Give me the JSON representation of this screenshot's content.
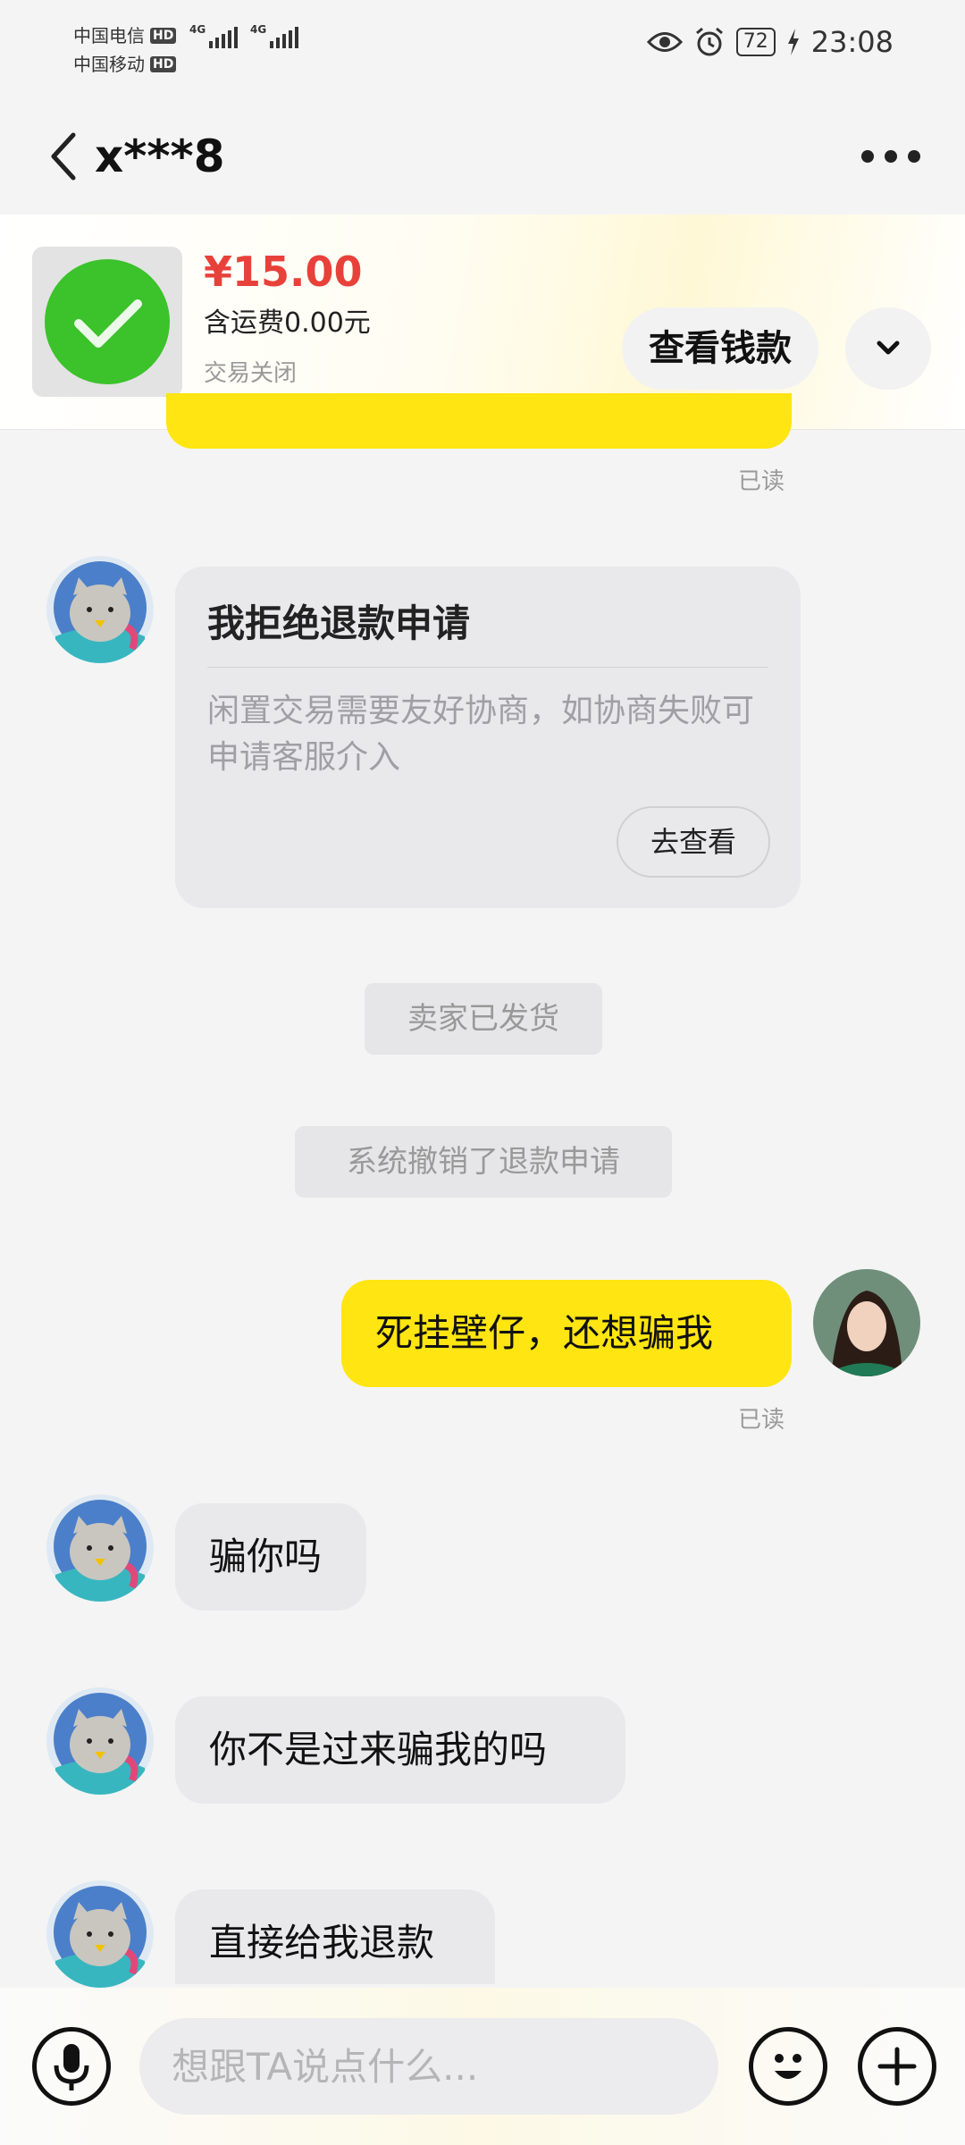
{
  "status_bar": {
    "carrier1": "中国电信",
    "carrier2": "中国移动",
    "hd": "HD",
    "net1": "4G",
    "net2": "4G",
    "battery": "72",
    "time": "23:08"
  },
  "nav": {
    "title": "x***8"
  },
  "order": {
    "price": "¥15.00",
    "shipping": "含运费0.00元",
    "status": "交易关闭",
    "view_money_label": "查看钱款"
  },
  "chat": {
    "read_label_1": "已读",
    "refund_card": {
      "title": "我拒绝退款申请",
      "description": "闲置交易需要友好协商，如协商失败可申请客服介入",
      "button": "去查看"
    },
    "system_1": "卖家已发货",
    "system_2": "系统撤销了退款申请",
    "my_message": "死挂壁仔，还想骗我",
    "read_label_2": "已读",
    "other_messages": [
      "骗你吗",
      "你不是过来骗我的吗",
      "直接给我退款"
    ]
  },
  "input_bar": {
    "placeholder": "想跟TA说点什么..."
  },
  "colors": {
    "accent_yellow": "#ffe511",
    "price_red": "#e8413a",
    "success_green": "#3cc22b"
  },
  "icons": [
    "back-icon",
    "more-icon",
    "chevron-down-icon",
    "voice-icon",
    "emoji-icon",
    "add-icon",
    "check-icon",
    "eye-icon",
    "alarm-icon",
    "charging-icon"
  ]
}
